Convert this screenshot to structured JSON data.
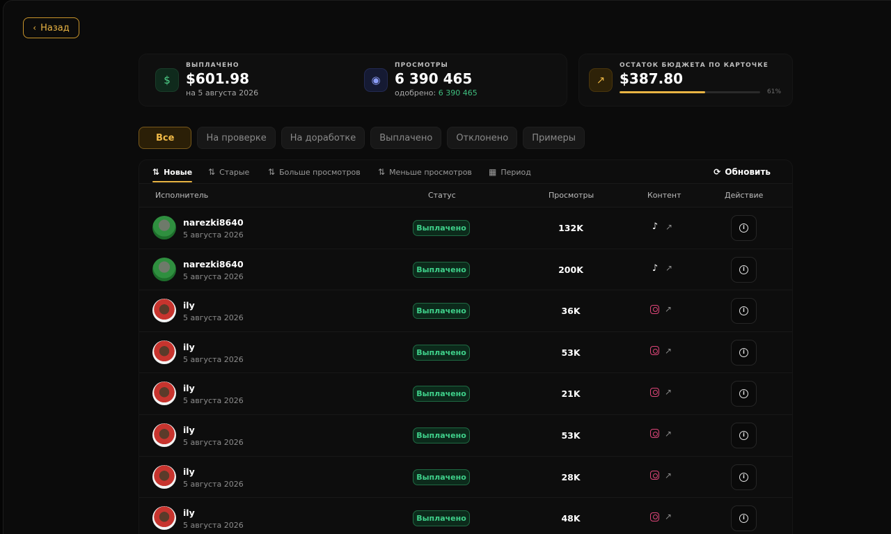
{
  "nav": {
    "back_label": "Назад"
  },
  "stats": {
    "paid": {
      "label": "ВЫПЛАЧЕНО",
      "value": "$601.98",
      "sub": "на 5 августа 2026"
    },
    "views": {
      "label": "ПРОСМОТРЫ",
      "value": "6 390 465",
      "sub_prefix": "одобрено:",
      "sub_value": "6 390 465"
    },
    "budget": {
      "label": "ОСТАТОК БЮДЖЕТА ПО КАРТОЧКЕ",
      "value": "$387.80",
      "percent_label": "61%",
      "percent": 61
    }
  },
  "filters": [
    "Все",
    "На проверке",
    "На доработке",
    "Выплачено",
    "Отклонено",
    "Примеры"
  ],
  "sorts": [
    "Новые",
    "Старые",
    "Больше просмотров",
    "Меньше просмотров",
    "Период"
  ],
  "refresh_label": "Обновить",
  "columns": {
    "performer": "Исполнитель",
    "status": "Статус",
    "views": "Просмотры",
    "content": "Контент",
    "action": "Действие"
  },
  "rows": [
    {
      "name": "narezki8640",
      "date": "5 августа 2026",
      "status": "Выплачено",
      "views": "132K",
      "platform": "tiktok-icon"
    },
    {
      "name": "narezki8640",
      "date": "5 августа 2026",
      "status": "Выплачено",
      "views": "200K",
      "platform": "tiktok-icon"
    },
    {
      "name": "ily",
      "date": "5 августа 2026",
      "status": "Выплачено",
      "views": "36K",
      "platform": "instagram-icon"
    },
    {
      "name": "ily",
      "date": "5 августа 2026",
      "status": "Выплачено",
      "views": "53K",
      "platform": "instagram-icon"
    },
    {
      "name": "ily",
      "date": "5 августа 2026",
      "status": "Выплачено",
      "views": "21K",
      "platform": "instagram-icon"
    },
    {
      "name": "ily",
      "date": "5 августа 2026",
      "status": "Выплачено",
      "views": "53K",
      "platform": "instagram-icon"
    },
    {
      "name": "ily",
      "date": "5 августа 2026",
      "status": "Выплачено",
      "views": "28K",
      "platform": "instagram-icon"
    },
    {
      "name": "ily",
      "date": "5 августа 2026",
      "status": "Выплачено",
      "views": "48K",
      "platform": "instagram-icon"
    }
  ],
  "colors": {
    "accent": "#e9b443",
    "success": "#3fd08a",
    "background": "#0b0b0b"
  }
}
